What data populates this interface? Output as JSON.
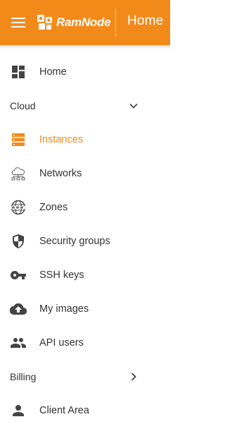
{
  "header": {
    "brand_name": "RamNode",
    "page_title": "Home",
    "colors": {
      "bar": "#f28a1a",
      "text": "#ffffff"
    },
    "menu_icon": "hamburger-menu-icon",
    "logo_icon": "ramnode-logo-icon"
  },
  "sidebar": {
    "colors": {
      "text": "#333333",
      "icon": "#444444",
      "active": "#f28a1a"
    },
    "home": {
      "label": "Home",
      "icon": "dashboard-icon"
    },
    "cloud": {
      "label": "Cloud",
      "expanded": true,
      "chevron_icon": "chevron-down-icon",
      "items": [
        {
          "label": "Instances",
          "icon": "server-stack-icon",
          "active": true
        },
        {
          "label": "Networks",
          "icon": "cloud-network-icon",
          "active": false
        },
        {
          "label": "Zones",
          "icon": "globe-www-icon",
          "active": false
        },
        {
          "label": "Security groups",
          "icon": "shield-icon",
          "active": false
        },
        {
          "label": "SSH keys",
          "icon": "key-icon",
          "active": false
        },
        {
          "label": "My images",
          "icon": "cloud-upload-icon",
          "active": false
        },
        {
          "label": "API users",
          "icon": "users-icon",
          "active": false
        }
      ]
    },
    "billing": {
      "label": "Billing",
      "expanded": false,
      "chevron_icon": "chevron-right-icon"
    },
    "client_area": {
      "label": "Client Area",
      "icon": "person-icon"
    }
  }
}
